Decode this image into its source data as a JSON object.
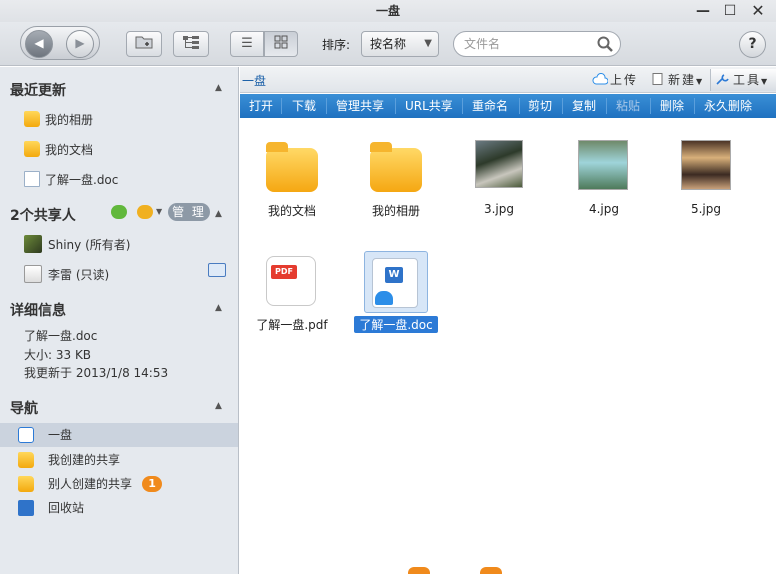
{
  "window": {
    "title": "一盘"
  },
  "toolbar": {
    "sort_label": "排序:",
    "sort_value": "按名称",
    "search_placeholder": "文件名",
    "help_label": "?"
  },
  "sidebar": {
    "recent": {
      "title": "最近更新",
      "items": [
        "我的相册",
        "我的文档",
        "了解一盘.doc"
      ]
    },
    "sharers": {
      "title": "2个共享人",
      "manage_label": "管 理",
      "people": [
        {
          "name": "Shiny (所有者)"
        },
        {
          "name": "李雷 (只读)"
        }
      ]
    },
    "details": {
      "title": "详细信息",
      "filename": "了解一盘.doc",
      "size": "大小: 33 KB",
      "updated": "我更新于 2013/1/8 14:53"
    },
    "nav": {
      "title": "导航",
      "items": [
        "一盘",
        "我创建的共享",
        "别人创建的共享",
        "回收站"
      ],
      "badge": "1"
    }
  },
  "main": {
    "path": "一盘",
    "actions": {
      "upload": "上传",
      "new": "新建",
      "tools": "工具"
    },
    "commands": [
      "打开",
      "下载",
      "管理共享",
      "URL共享",
      "重命名",
      "剪切",
      "复制",
      "粘贴",
      "删除",
      "永久删除"
    ],
    "files": [
      {
        "name": "我的文档",
        "kind": "folder"
      },
      {
        "name": "我的相册",
        "kind": "folder"
      },
      {
        "name": "3.jpg",
        "kind": "image"
      },
      {
        "name": "4.jpg",
        "kind": "image"
      },
      {
        "name": "5.jpg",
        "kind": "image"
      },
      {
        "name": "了解一盘.pdf",
        "kind": "pdf"
      },
      {
        "name": "了解一盘.doc",
        "kind": "doc",
        "selected": true
      }
    ]
  },
  "colors": {
    "accent": "#2c7ad6",
    "command_bar": "#1f71c0",
    "badge": "#f08a1c",
    "sidebar_bg": "#e5e9ee"
  }
}
